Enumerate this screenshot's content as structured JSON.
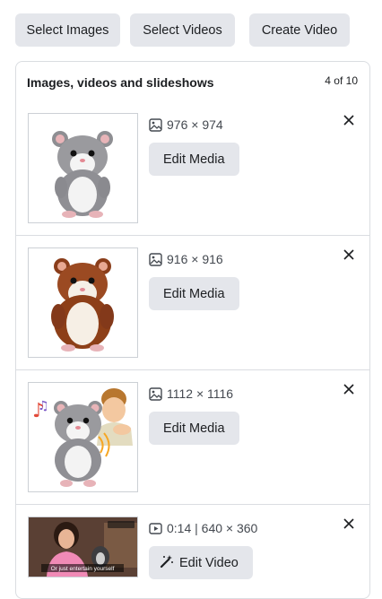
{
  "toolbar": {
    "select_images": "Select Images",
    "select_videos": "Select Videos",
    "create_video": "Create Video"
  },
  "panel": {
    "title": "Images, videos and slideshows",
    "count": "4 of 10"
  },
  "media": [
    {
      "kind": "image",
      "dimensions": "976 × 974",
      "action": "Edit Media",
      "icon": "image-icon",
      "thumbnail": "grey hamster plush toy"
    },
    {
      "kind": "image",
      "dimensions": "916 × 916",
      "action": "Edit Media",
      "icon": "image-icon",
      "thumbnail": "brown hamster plush toy"
    },
    {
      "kind": "image",
      "dimensions": "1112 × 1116",
      "action": "Edit Media",
      "icon": "image-icon",
      "thumbnail": "grey hamster toy with child and music notes"
    },
    {
      "kind": "video",
      "dimensions": "0:14 | 640 × 360",
      "action": "Edit Video",
      "icon": "video-icon",
      "thumbnail": "woman holding hamster toy",
      "video_caption": "Or just entertain yourself"
    }
  ],
  "colors": {
    "button_bg": "#e4e6eb",
    "border": "#dadde1",
    "text": "#1c1e21",
    "muted": "#444950"
  }
}
